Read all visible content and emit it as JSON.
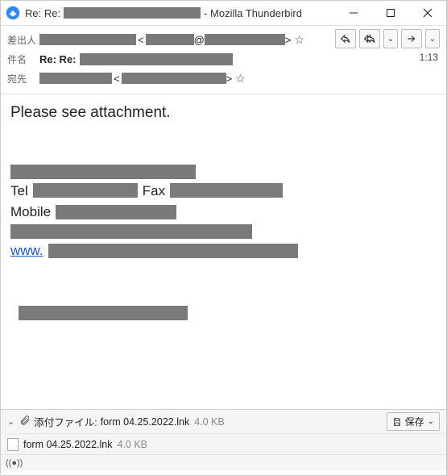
{
  "titlebar": {
    "prefix": "Re: Re:",
    "suffix": "- Mozilla Thunderbird"
  },
  "headers": {
    "from_label": "差出人",
    "subject_label": "件名",
    "to_label": "宛先",
    "subject_prefix": "Re: Re:",
    "time": "1:13",
    "angle_open": "<",
    "angle_close": ">",
    "at": "@"
  },
  "toolbar": {
    "reply": "↰",
    "reply_all": "↰",
    "forward": "→",
    "more": "⌄"
  },
  "body": {
    "intro": "Please see attachment.",
    "tel_label": "Tel",
    "fax_label": "Fax",
    "mobile_label": "Mobile",
    "www_label": "www."
  },
  "attachment": {
    "bar_label": "添付ファイル:",
    "filename": "form 04.25.2022.lnk",
    "size": "4.0 KB",
    "save_label": "保存"
  },
  "status": {
    "icon": "📡"
  }
}
